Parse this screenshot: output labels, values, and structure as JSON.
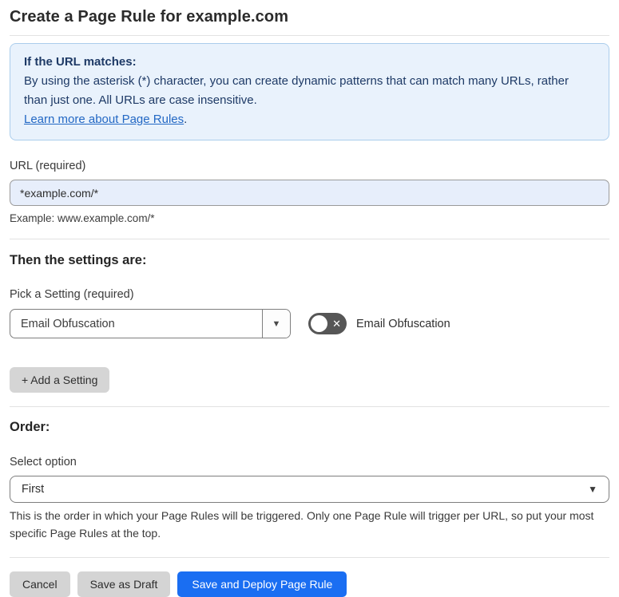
{
  "page": {
    "title": "Create a Page Rule for example.com"
  },
  "info_box": {
    "heading": "If the URL matches:",
    "body": "By using the asterisk (*) character, you can create dynamic patterns that can match many URLs, rather than just one. All URLs are case insensitive.",
    "link_label": "Learn more about Page Rules",
    "link_suffix": "."
  },
  "url_field": {
    "label": "URL (required)",
    "value": "*example.com/*",
    "helper": "Example: www.example.com/*"
  },
  "settings_section": {
    "heading": "Then the settings are:",
    "picker_label": "Pick a Setting (required)",
    "picker_value": "Email Obfuscation",
    "toggle_label": "Email Obfuscation",
    "toggle_state": "off",
    "add_button_label": "+ Add a Setting"
  },
  "order_section": {
    "heading": "Order:",
    "select_label": "Select option",
    "select_value": "First",
    "helper": "This is the order in which your Page Rules will be triggered. Only one Page Rule will trigger per URL, so put your most specific Page Rules at the top."
  },
  "footer": {
    "cancel_label": "Cancel",
    "save_draft_label": "Save as Draft",
    "save_deploy_label": "Save and Deploy Page Rule"
  },
  "icons": {
    "caret_down": "▼",
    "toggle_off_x": "✕"
  },
  "colors": {
    "accent_blue": "#1a6ef2",
    "info_box_bg": "#e9f2fc",
    "info_box_border": "#abcdec",
    "info_text": "#1e3a66",
    "link_blue": "#2368c4",
    "url_input_bg": "#e7eefb",
    "toggle_off_bg": "#565656",
    "gray_button_bg": "#d4d4d4"
  }
}
